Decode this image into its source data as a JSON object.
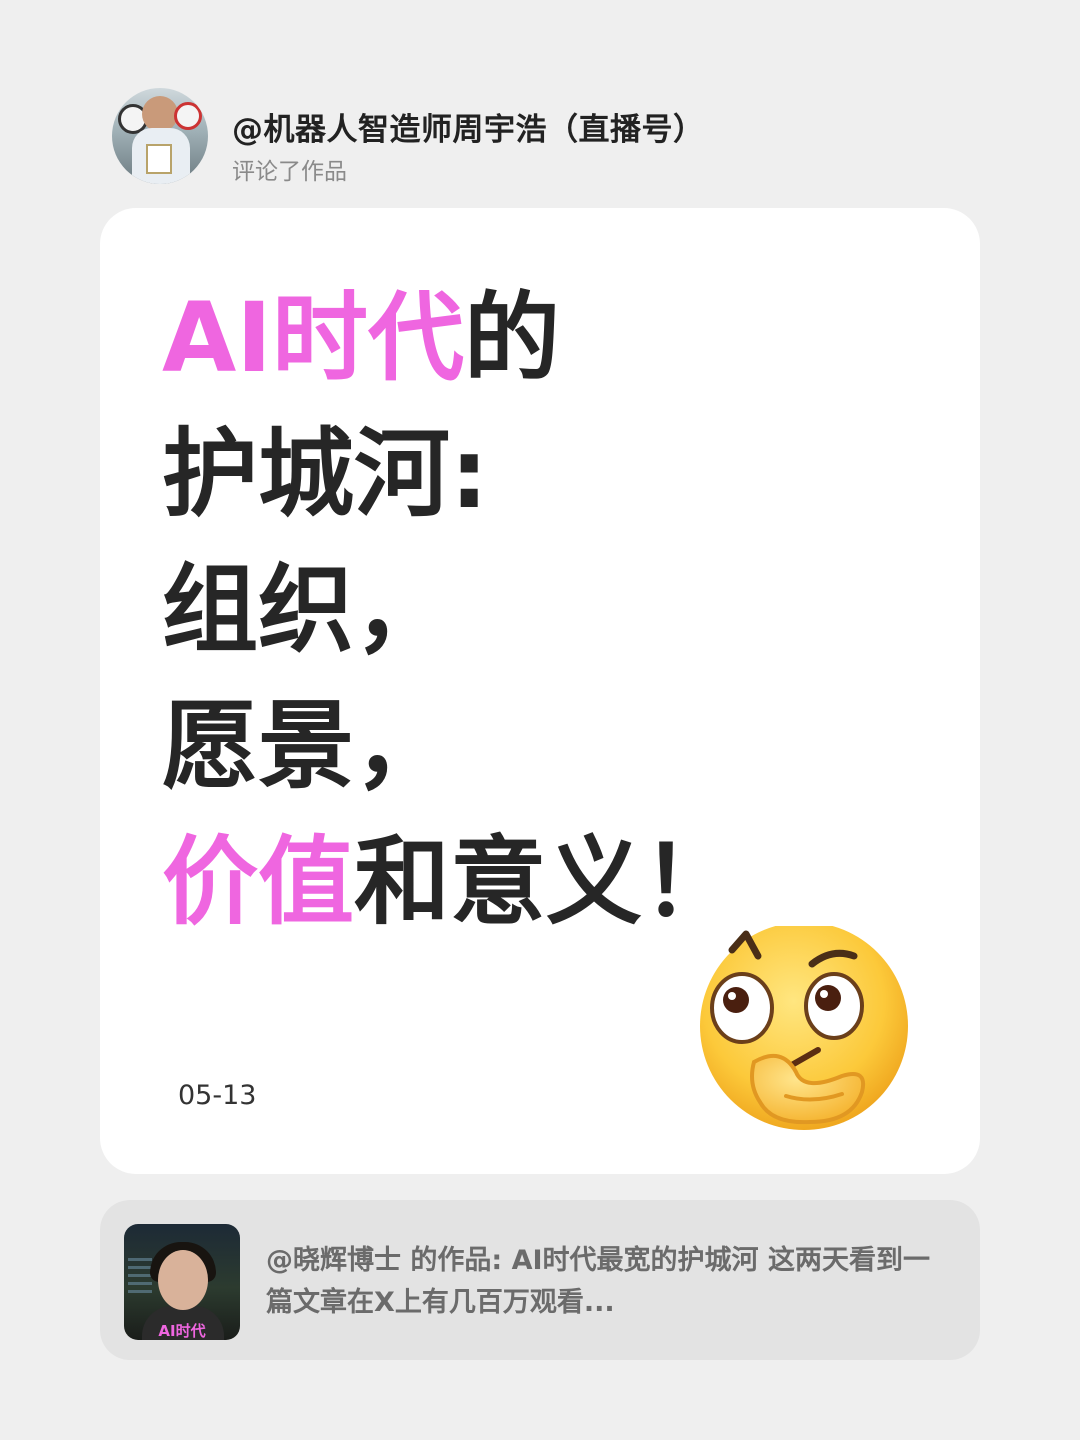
{
  "comment": {
    "username": "@机器人智造师周宇浩（直播号）",
    "action": "评论了作品"
  },
  "card": {
    "headline": [
      {
        "pink": "AI时代",
        "dark": "的"
      },
      {
        "pink": "",
        "dark": "护城河:"
      },
      {
        "pink": "",
        "dark": "组织，"
      },
      {
        "pink": "",
        "dark": "愿景，"
      },
      {
        "pink": "价值",
        "dark": "和意义！"
      }
    ],
    "date": "05-13",
    "emoji": "thinking-face-emoji",
    "accent_color": "#ef66e0"
  },
  "quoted_work": {
    "thumbnail_tag": "AI时代",
    "text": "@晓辉博士 的作品: AI时代最宽的护城河 这两天看到一篇文章在X上有几百万观看..."
  }
}
